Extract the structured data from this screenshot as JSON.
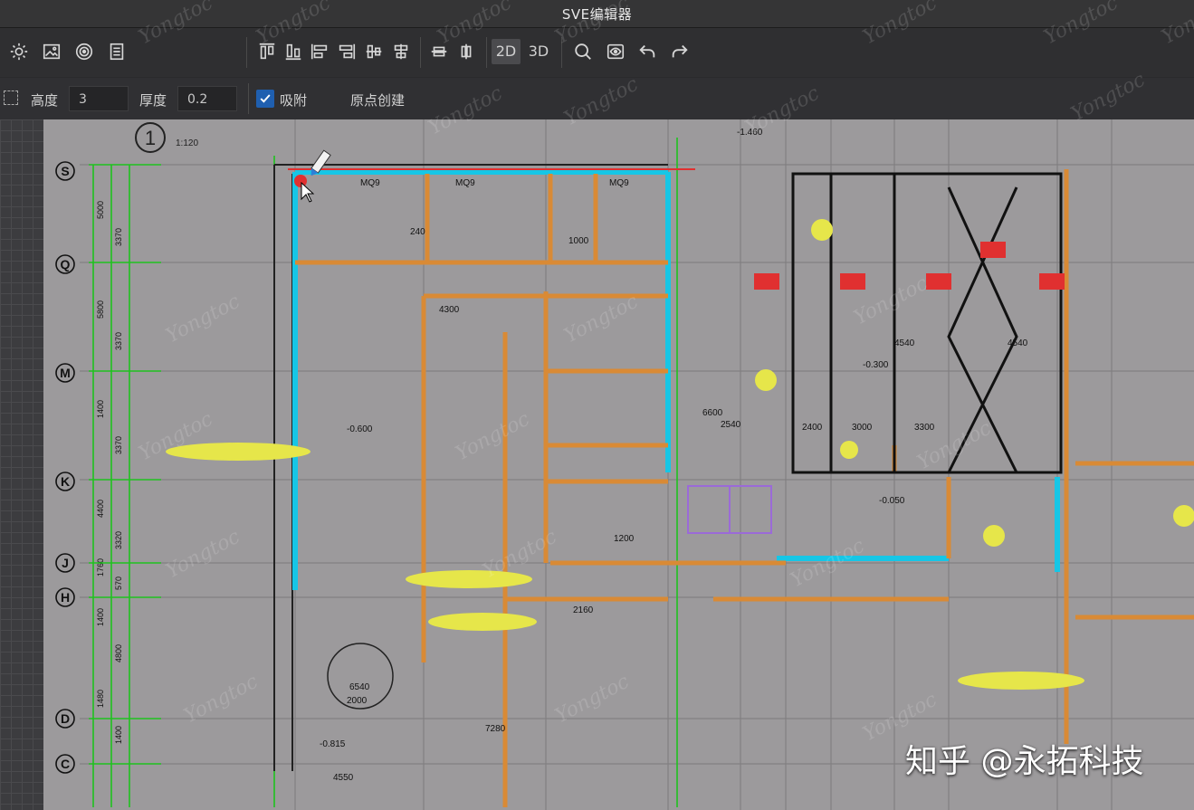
{
  "window": {
    "title": "SVE编辑器"
  },
  "toolbar": {
    "icons": [
      "sun-icon",
      "image-icon",
      "target-icon",
      "document-icon",
      "align-top-icon",
      "align-bottom-icon",
      "align-left-icon",
      "align-right-icon",
      "align-center-v-icon",
      "align-center-h-icon",
      "distribute-h-icon",
      "distribute-v-icon",
      "search-icon",
      "view-icon",
      "undo-icon",
      "redo-icon"
    ],
    "mode_2d": "2D",
    "mode_3d": "3D"
  },
  "props": {
    "height_label": "高度",
    "height_value": "3",
    "thickness_label": "厚度",
    "thickness_value": "0.2",
    "snap_label": "吸附",
    "snap_checked": true,
    "origin_label": "原点创建"
  },
  "drawing": {
    "view_number": "1",
    "scale": "1:120",
    "axis_labels": [
      "S",
      "Q",
      "M",
      "K",
      "J",
      "H",
      "D",
      "C"
    ],
    "dims_left": [
      "5000",
      "3370",
      "5800",
      "3370",
      "1400",
      "3370",
      "4400",
      "3320",
      "1760",
      "570",
      "1400",
      "4800",
      "1480",
      "1400"
    ],
    "room_labels": {
      "m09a": "MQ9",
      "m09b": "MQ9",
      "m09c": "MQ9",
      "dim_240": "240",
      "dim_1000": "1000",
      "dim_4300": "4300",
      "dim_4540a": "4540",
      "dim_4540b": "4540",
      "dim_2400": "2400",
      "dim_3000": "3000",
      "dim_3300": "3300",
      "dim_1200": "1200",
      "level_a": "-0.600",
      "level_b": "-0.300",
      "level_c": "-0.050",
      "level_d": "-0.815",
      "level_e": "-1.460",
      "dim_6540": "6540",
      "dim_2000": "2000",
      "dim_7280": "7280",
      "dim_2540": "2540",
      "dim_6600": "6600",
      "dim_2160": "2160",
      "dim_4550": "4550"
    }
  },
  "watermark": {
    "text": "知乎 @永拓科技",
    "brand": "Yongtoc"
  }
}
